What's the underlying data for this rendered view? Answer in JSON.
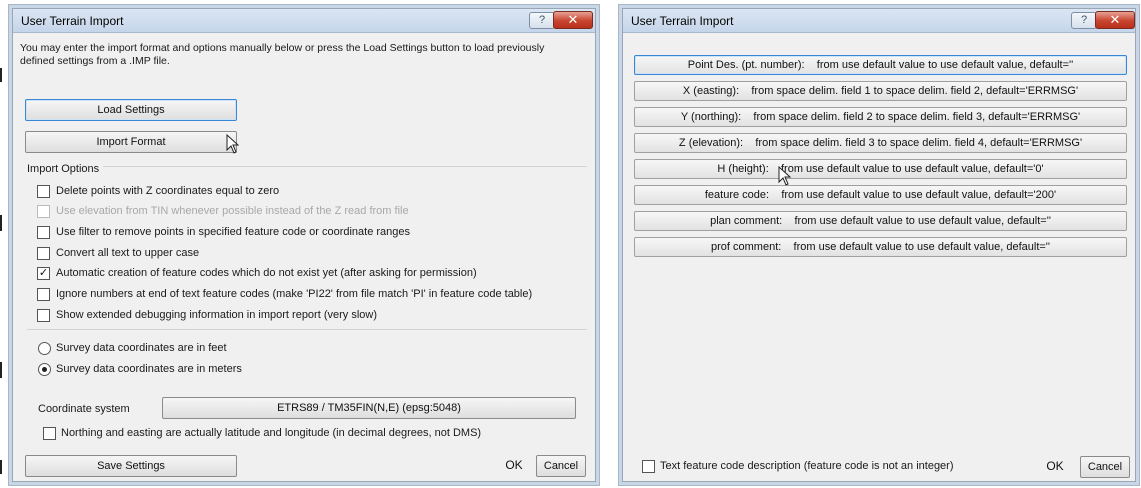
{
  "left_dialog": {
    "title": "User Terrain Import",
    "help_label": "?",
    "close_label": "✕",
    "intro_line1": "You may enter the import format and options manually below or press the Load Settings button to load previously",
    "intro_line2": "defined settings from a .IMP file.",
    "load_settings_label": "Load Settings",
    "import_format_label": "Import Format",
    "import_options_title": "Import Options",
    "options": [
      {
        "label": "Delete points with Z coordinates equal to zero",
        "checked": false,
        "disabled": false
      },
      {
        "label": "Use elevation from TIN whenever possible instead of the Z read from file",
        "checked": false,
        "disabled": true
      },
      {
        "label": "Use filter to remove points in specified feature code or coordinate ranges",
        "checked": false,
        "disabled": false
      },
      {
        "label": "Convert all text to upper case",
        "checked": false,
        "disabled": false
      },
      {
        "label": "Automatic creation of feature codes which do not exist yet (after asking for permission)",
        "checked": true,
        "disabled": false
      },
      {
        "label": "Ignore numbers at end of text feature codes (make 'PI22' from file match 'PI' in feature code table)",
        "checked": false,
        "disabled": false
      },
      {
        "label": "Show extended debugging information in import report (very slow)",
        "checked": false,
        "disabled": false
      }
    ],
    "units": [
      {
        "label": "Survey data coordinates are in feet",
        "selected": false
      },
      {
        "label": "Survey data coordinates are in meters",
        "selected": true
      }
    ],
    "coordinate_system_label": "Coordinate system",
    "coordinate_system_value": "ETRS89 / TM35FIN(N,E) (epsg:5048)",
    "latlon_label": "Northing and easting are actually latitude and longitude (in decimal degrees, not DMS)",
    "latlon_checked": false,
    "save_settings_label": "Save Settings",
    "ok_label": "OK",
    "cancel_label": "Cancel"
  },
  "right_dialog": {
    "title": "User Terrain Import",
    "help_label": "?",
    "close_label": "✕",
    "fields": [
      {
        "name": "Point Des. (pt. number):",
        "desc": "from use default value to use default value, default=''"
      },
      {
        "name": "X (easting):",
        "desc": "from space delim. field 1 to space delim. field 2, default='ERRMSG'"
      },
      {
        "name": "Y (northing):",
        "desc": "from space delim. field 2 to space delim. field 3, default='ERRMSG'"
      },
      {
        "name": "Z (elevation):",
        "desc": "from space delim. field 3 to space delim. field 4, default='ERRMSG'"
      },
      {
        "name": "H (height):",
        "desc": "from use default value to use default value, default='0'"
      },
      {
        "name": "feature code:",
        "desc": "from use default value to use default value, default='200'"
      },
      {
        "name": "plan comment:",
        "desc": "from use default value to use default value, default=''"
      },
      {
        "name": "prof comment:",
        "desc": "from use default value to use default value, default=''"
      }
    ],
    "text_feature_label": "Text feature code description  (feature code is not an integer)",
    "text_feature_checked": false,
    "ok_label": "OK",
    "cancel_label": "Cancel"
  }
}
